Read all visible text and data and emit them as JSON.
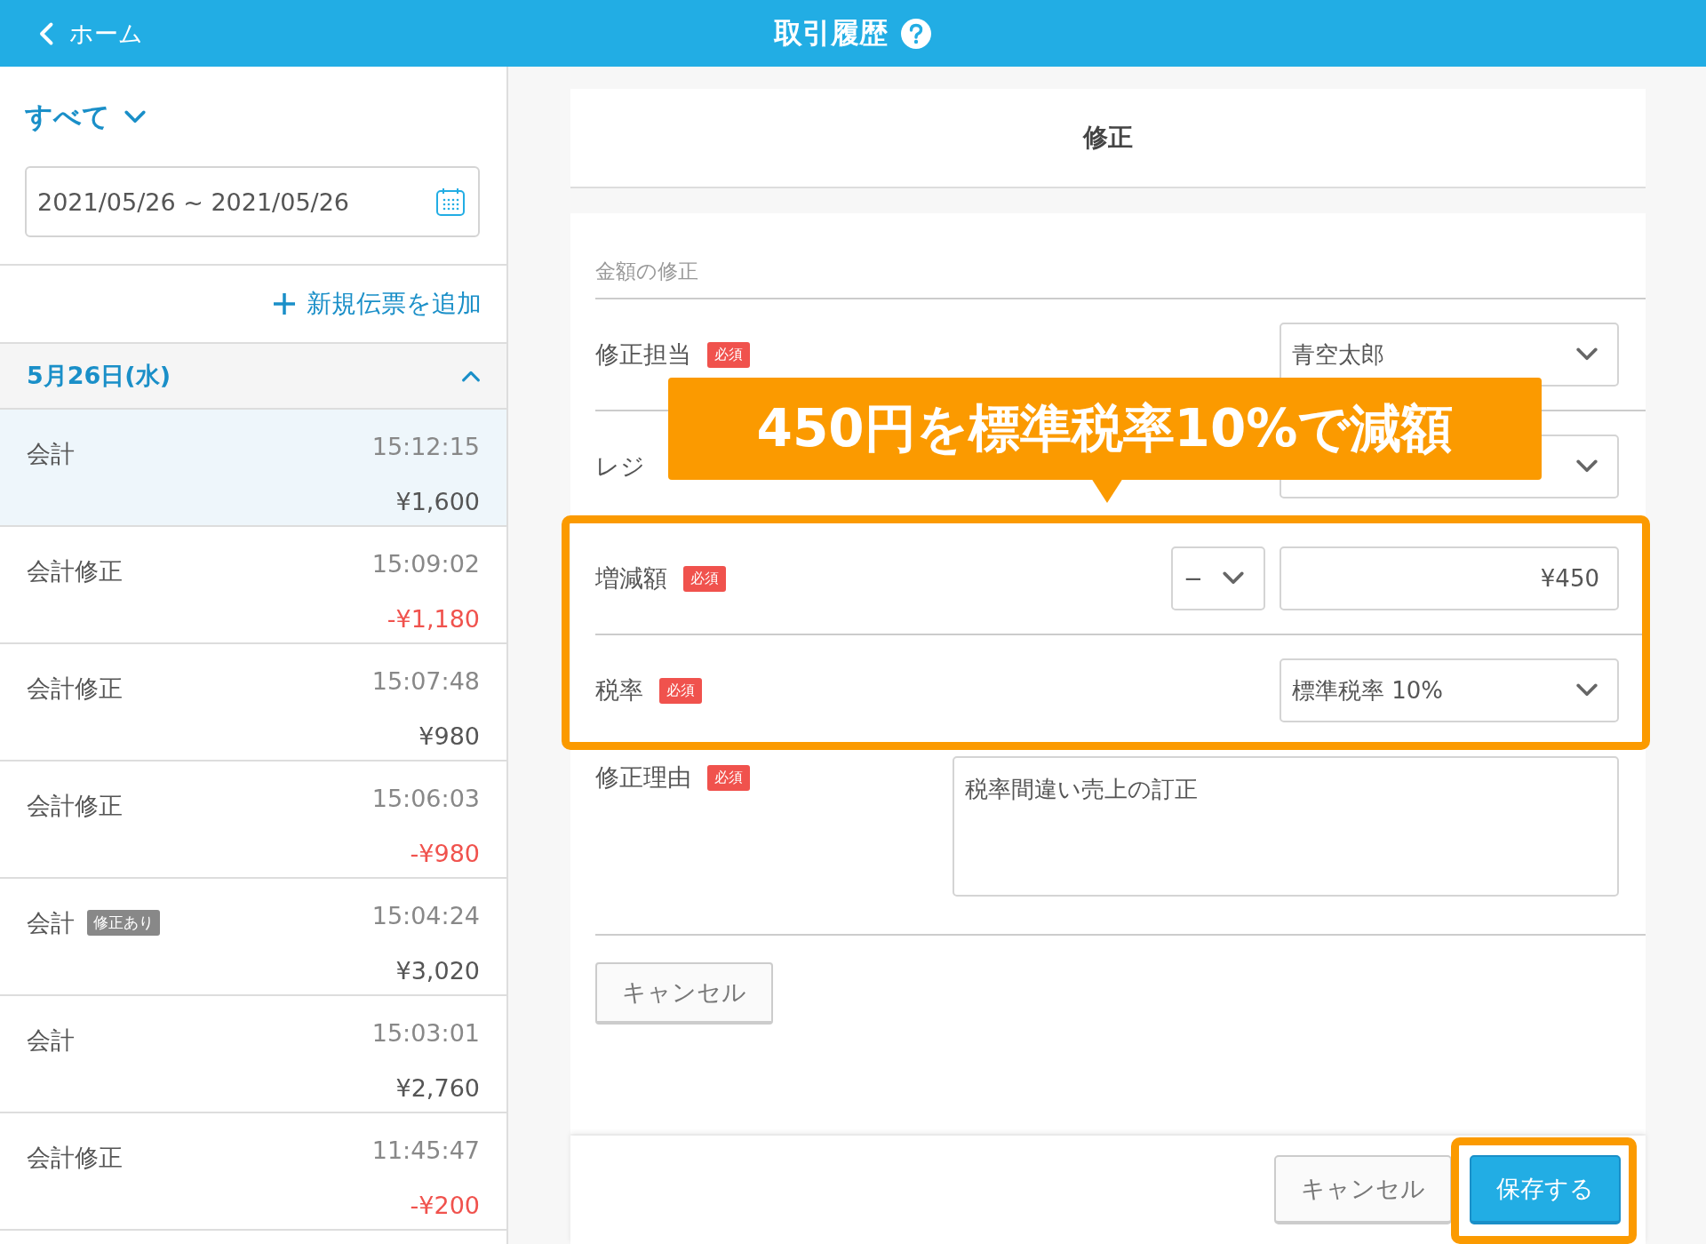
{
  "header": {
    "back_label": "ホーム",
    "title": "取引履歴"
  },
  "sidebar": {
    "filter": "すべて",
    "date_range": "2021/05/26 ~ 2021/05/26",
    "add_link": "新規伝票を追加",
    "group": {
      "label": "5月26日(水)",
      "expanded": true
    },
    "transactions": [
      {
        "title": "会計",
        "time": "15:12:15",
        "amount": "¥1,600",
        "negative": false,
        "selected": true
      },
      {
        "title": "会計修正",
        "time": "15:09:02",
        "amount": "-¥1,180",
        "negative": true,
        "selected": false
      },
      {
        "title": "会計修正",
        "time": "15:07:48",
        "amount": "¥980",
        "negative": false,
        "selected": false
      },
      {
        "title": "会計修正",
        "time": "15:06:03",
        "amount": "-¥980",
        "negative": true,
        "selected": false
      },
      {
        "title": "会計",
        "badge": "修正あり",
        "time": "15:04:24",
        "amount": "¥3,020",
        "negative": false,
        "selected": false
      },
      {
        "title": "会計",
        "time": "15:03:01",
        "amount": "¥2,760",
        "negative": false,
        "selected": false
      },
      {
        "title": "会計修正",
        "time": "11:45:47",
        "amount": "-¥200",
        "negative": true,
        "selected": false
      }
    ]
  },
  "panel": {
    "title": "修正",
    "section": "金額の修正",
    "fields": [
      {
        "kind": "select",
        "label": "修正担当",
        "badge": "必須",
        "value": "青空太郎"
      },
      {
        "kind": "select",
        "label": "レジ"
      },
      {
        "kind": "amount",
        "label": "増減額",
        "badge": "必須",
        "sign": "−",
        "value": "¥450"
      },
      {
        "kind": "select",
        "label": "税率",
        "badge": "必須",
        "value": "標準税率 10%"
      },
      {
        "kind": "textarea",
        "label": "修正理由",
        "badge": "必須",
        "value": "税率間違い売上の訂正"
      }
    ],
    "cancel_button": "キャンセル",
    "footer_buttons": [
      {
        "kind": "secondary",
        "label": "キャンセル"
      },
      {
        "kind": "primary",
        "label": "保存する"
      }
    ]
  },
  "callout": "450円を標準税率10%で減額"
}
